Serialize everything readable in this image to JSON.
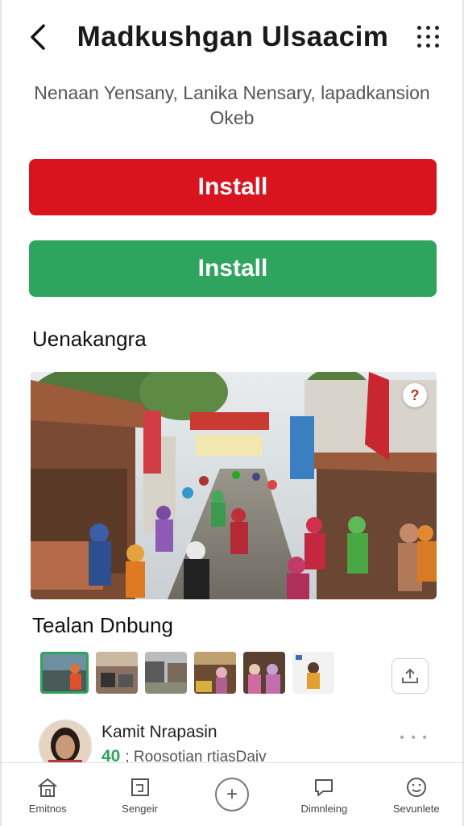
{
  "header": {
    "title": "Madkushgan Ulsaacim",
    "back_icon": "chevron-left-icon",
    "more_icon": "more-dots-icon"
  },
  "subtitle": "Nenaan Yensany, Lanika Nensary, lapadkansion Okeb",
  "buttons": {
    "primary_label": "Install",
    "primary_color": "#d9141e",
    "secondary_label": "Install",
    "secondary_color": "#2ea45e"
  },
  "sections": {
    "gallery_title": "Uenakangra",
    "thumbs_title": "Tealan Dnbung"
  },
  "photo": {
    "help_badge": "?"
  },
  "thumbnails": [
    {
      "name": "thumb-1",
      "active": true
    },
    {
      "name": "thumb-2",
      "active": false
    },
    {
      "name": "thumb-3",
      "active": false
    },
    {
      "name": "thumb-4",
      "active": false
    },
    {
      "name": "thumb-5",
      "active": false
    },
    {
      "name": "thumb-6",
      "active": false
    }
  ],
  "comment": {
    "name": "Kamit Nrapasin",
    "count": "40",
    "text": "; Roosotian rtiasDaiv",
    "more": "• • •"
  },
  "bottom_nav": [
    {
      "label": "Emitnos",
      "icon": "home-icon"
    },
    {
      "label": "Sengeir",
      "icon": "calendar-icon"
    },
    {
      "label": "",
      "icon": "add-icon"
    },
    {
      "label": "Dimnleing",
      "icon": "chat-icon"
    },
    {
      "label": "Sevunlete",
      "icon": "profile-icon"
    }
  ]
}
